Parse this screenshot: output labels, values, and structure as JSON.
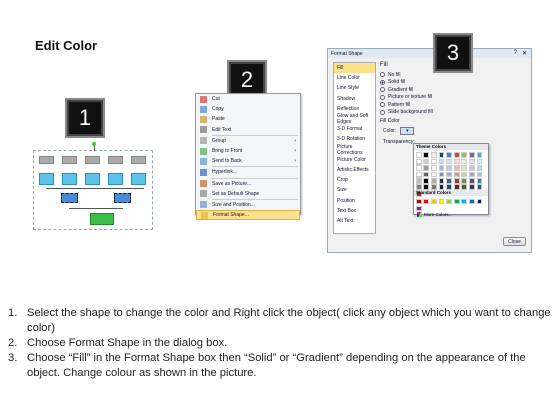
{
  "title": "Edit Color",
  "badges": [
    "1",
    "2",
    "3"
  ],
  "context_menu": {
    "items": [
      {
        "label": "Cut",
        "icon": "scissors-icon"
      },
      {
        "label": "Copy",
        "icon": "copy-icon"
      },
      {
        "label": "Paste",
        "icon": "paste-icon"
      },
      {
        "label": "Edit Text",
        "icon": "edit-text-icon"
      },
      {
        "label": "Group",
        "icon": "group-icon",
        "submenu": true
      },
      {
        "label": "Bring to Front",
        "icon": "bring-front-icon",
        "submenu": true
      },
      {
        "label": "Send to Back",
        "icon": "send-back-icon",
        "submenu": true
      },
      {
        "label": "Hyperlink...",
        "icon": "hyperlink-icon"
      },
      {
        "label": "Save as Picture...",
        "icon": "save-picture-icon"
      },
      {
        "label": "Set as Default Shape",
        "icon": "default-shape-icon"
      },
      {
        "label": "Size and Position...",
        "icon": "size-position-icon"
      },
      {
        "label": "Format Shape...",
        "icon": "format-shape-icon",
        "selected": true
      }
    ]
  },
  "dialog": {
    "title": "Format Shape",
    "nav": [
      "Fill",
      "Line Color",
      "Line Style",
      "Shadow",
      "Reflection",
      "Glow and Soft Edges",
      "3-D Format",
      "3-D Rotation",
      "Picture Corrections",
      "Picture Color",
      "Artistic Effects",
      "Crop",
      "Size",
      "Position",
      "Text Box",
      "Alt Text"
    ],
    "section": "Fill",
    "options": [
      {
        "label": "No fill",
        "on": false
      },
      {
        "label": "Solid fill",
        "on": true
      },
      {
        "label": "Gradient fill",
        "on": false
      },
      {
        "label": "Picture or texture fill",
        "on": false
      },
      {
        "label": "Pattern fill",
        "on": false
      },
      {
        "label": "Slide background fill",
        "on": false
      }
    ],
    "fill_color_label": "Fill Color",
    "color_label": "Color:",
    "transparency_label": "Transparency:",
    "close_label": "Close",
    "palette": {
      "theme_header": "Theme Colors",
      "standard_header": "Standard Colors",
      "more_label": "More Colors...",
      "theme_top": [
        "#ffffff",
        "#000000",
        "#eeece1",
        "#1f497d",
        "#4f81bd",
        "#c0504d",
        "#9bbb59",
        "#8064a2",
        "#4bacc6",
        "#f79646"
      ],
      "standard": [
        "#c00000",
        "#ff0000",
        "#ffc000",
        "#ffff00",
        "#92d050",
        "#00b050",
        "#00b0f0",
        "#0070c0",
        "#002060",
        "#7030a0"
      ]
    }
  },
  "instructions": [
    {
      "num": "1.",
      "text": "Select the shape to change the color and Right click the object( click any object which you want to change color)"
    },
    {
      "num": "2.",
      "text": "Choose Format Shape in the dialog box."
    },
    {
      "num": "3.",
      "text": "Choose “Fill” in the Format Shape box then “Solid” or “Gradient” depending on the appearance of the object. Change colour as shown in the picture."
    }
  ]
}
